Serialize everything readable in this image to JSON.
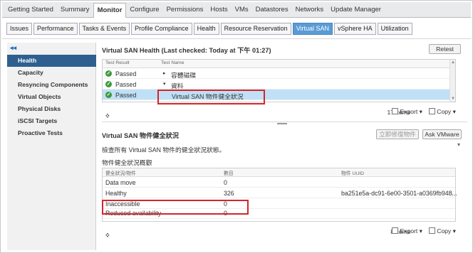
{
  "top_tabs": [
    "Getting Started",
    "Summary",
    "Monitor",
    "Configure",
    "Permissions",
    "Hosts",
    "VMs",
    "Datastores",
    "Networks",
    "Update Manager"
  ],
  "top_tab_active": "Monitor",
  "sub_tabs": [
    "Issues",
    "Performance",
    "Tasks & Events",
    "Profile Compliance",
    "Health",
    "Resource Reservation",
    "Virtual SAN",
    "vSphere HA",
    "Utilization"
  ],
  "sub_tab_active": "Virtual SAN",
  "sidebar": {
    "collapse_glyph": "◂◂",
    "items": [
      "Health",
      "Capacity",
      "Resyncing Components",
      "Virtual Objects",
      "Physical Disks",
      "iSCSI Targets",
      "Proactive Tests"
    ],
    "active": "Health"
  },
  "health_panel": {
    "title": "Virtual SAN Health (Last checked: Today at 下午 01:27)",
    "retest_label": "Retest",
    "columns": [
      "Test Result",
      "Test Name"
    ],
    "rows": [
      {
        "result": "Passed",
        "expander": "▸",
        "name": "容體磁碟",
        "selected": false
      },
      {
        "result": "Passed",
        "expander": "▾",
        "name": "資料",
        "selected": false
      },
      {
        "result": "Passed",
        "expander": "",
        "name": "Virtual SAN 物件健全狀況",
        "selected": true
      }
    ],
    "footer": {
      "items": "17 items",
      "export": "Export",
      "copy": "Copy"
    }
  },
  "object_panel": {
    "title": "Virtual SAN 物件健全狀況",
    "repair_label": "立即修復物件",
    "ask_label": "Ask VMware",
    "description": "檢查所有 Virtual SAN 物件的健全狀況狀態。",
    "subheading": "物件健全狀況概觀",
    "columns": [
      "健全狀況/物件",
      "數目",
      "物件 UUID"
    ],
    "rows": [
      {
        "state": "Data move",
        "count": "0",
        "uuid": ""
      },
      {
        "state": "Healthy",
        "count": "326",
        "uuid": "ba251e5a-dc91-6e00-3501-a0369fb948..."
      },
      {
        "state": "Inaccessible",
        "count": "0",
        "uuid": ""
      },
      {
        "state": "Reduced availability",
        "count": "0",
        "uuid": ""
      }
    ],
    "footer": {
      "items": "8 items",
      "export": "Export",
      "copy": "Copy"
    }
  },
  "colors": {
    "accent": "#2e5f8f",
    "tab_active": "#5a9bd5",
    "highlight": "#d2262b",
    "passed": "#3c9a3c"
  }
}
